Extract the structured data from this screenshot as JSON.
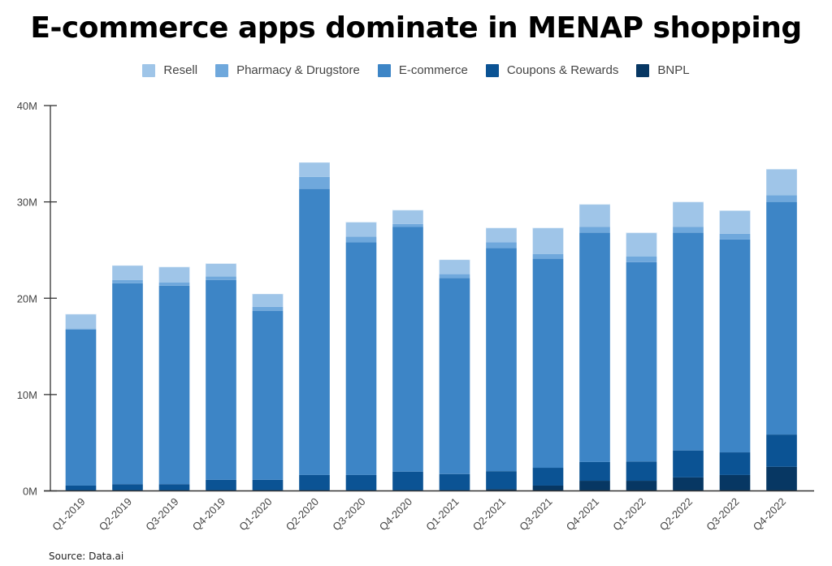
{
  "chart_data": {
    "type": "bar",
    "stacked": true,
    "title": "E-commerce apps dominate in MENAP shopping",
    "xlabel": "",
    "ylabel": "",
    "ylim": [
      0,
      40
    ],
    "y_unit": "M",
    "y_ticks": [
      "0M",
      "10M",
      "20M",
      "30M",
      "40M"
    ],
    "y_tick_values": [
      0,
      10,
      20,
      30,
      40
    ],
    "legend_position": "top",
    "grid": false,
    "source": "Source: Data.ai",
    "categories": [
      "Q1-2019",
      "Q2-2019",
      "Q3-2019",
      "Q4-2019",
      "Q1-2020",
      "Q2-2020",
      "Q3-2020",
      "Q4-2020",
      "Q1-2021",
      "Q2-2021",
      "Q3-2021",
      "Q4-2021",
      "Q1-2022",
      "Q2-2022",
      "Q3-2022",
      "Q4-2022"
    ],
    "series": [
      {
        "name": "BNPL",
        "color": "#073763",
        "values": [
          0,
          0,
          0,
          0,
          0,
          0,
          0,
          0,
          0,
          0.2,
          0.55,
          1.05,
          1.05,
          1.4,
          1.65,
          2.5
        ]
      },
      {
        "name": "Coupons & Rewards",
        "color": "#0b5394",
        "values": [
          0.55,
          0.7,
          0.7,
          1.15,
          1.15,
          1.65,
          1.65,
          2.0,
          1.75,
          1.85,
          1.85,
          1.95,
          2.0,
          2.8,
          2.35,
          3.35
        ]
      },
      {
        "name": "E-commerce",
        "color": "#3d85c6",
        "values": [
          16.2,
          20.85,
          20.6,
          20.75,
          17.55,
          29.7,
          24.15,
          25.4,
          20.35,
          23.15,
          21.7,
          23.8,
          20.7,
          22.6,
          22.1,
          24.15
        ]
      },
      {
        "name": "Pharmacy & Drugstore",
        "color": "#6fa8dc",
        "values": [
          0.1,
          0.35,
          0.35,
          0.35,
          0.4,
          1.25,
          0.6,
          0.3,
          0.4,
          0.6,
          0.5,
          0.6,
          0.6,
          0.6,
          0.6,
          0.7
        ]
      },
      {
        "name": "Resell",
        "color": "#9fc5e8",
        "values": [
          1.5,
          1.5,
          1.6,
          1.35,
          1.35,
          1.5,
          1.5,
          1.45,
          1.5,
          1.5,
          2.7,
          2.35,
          2.45,
          2.6,
          2.4,
          2.7
        ]
      }
    ],
    "legend_order": [
      "Resell",
      "Pharmacy & Drugstore",
      "E-commerce",
      "Coupons & Rewards",
      "BNPL"
    ]
  }
}
